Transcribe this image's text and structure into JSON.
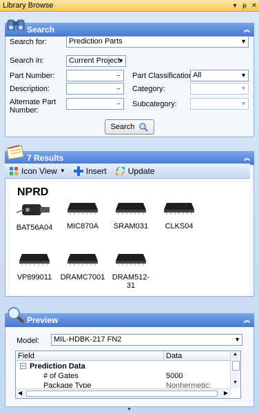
{
  "window": {
    "title": "Library Browse"
  },
  "search": {
    "header": "Search",
    "search_for_label": "Search for:",
    "search_for_value": "Prediction Parts",
    "search_in_label": "Search in:",
    "search_in_value": "Current Project",
    "part_number_label": "Part Number:",
    "description_label": "Description:",
    "alternate_label": "Alternate Part Number:",
    "part_class_label": "Part Classification:",
    "part_class_value": "All",
    "category_label": "Category:",
    "subcategory_label": "Subcategory:",
    "dots": "...",
    "search_button": "Search"
  },
  "results": {
    "header": "7 Results",
    "toolbar": {
      "view_label": "Icon View",
      "insert_label": "Insert",
      "update_label": "Update"
    },
    "badge": "NPRD",
    "items": [
      "BAT56A04",
      "MIC870A",
      "SRAM031",
      "CLKS04",
      "VP899011",
      "DRAMC7001",
      "DRAM512-31"
    ]
  },
  "preview": {
    "header": "Preview",
    "model_label": "Model:",
    "model_value": "MIL-HDBK-217 FN2",
    "columns": [
      "Field",
      "Data"
    ],
    "group": "Prediction Data",
    "rows": [
      {
        "field": "# of Gates",
        "data": "5000"
      },
      {
        "field": "Package Type",
        "data": "Nonhermetic: DIPs, P"
      }
    ]
  },
  "colors": {
    "header_blue": "#4578d4",
    "title_gold": "#f8c756",
    "panel_border": "#8fb0dd"
  }
}
